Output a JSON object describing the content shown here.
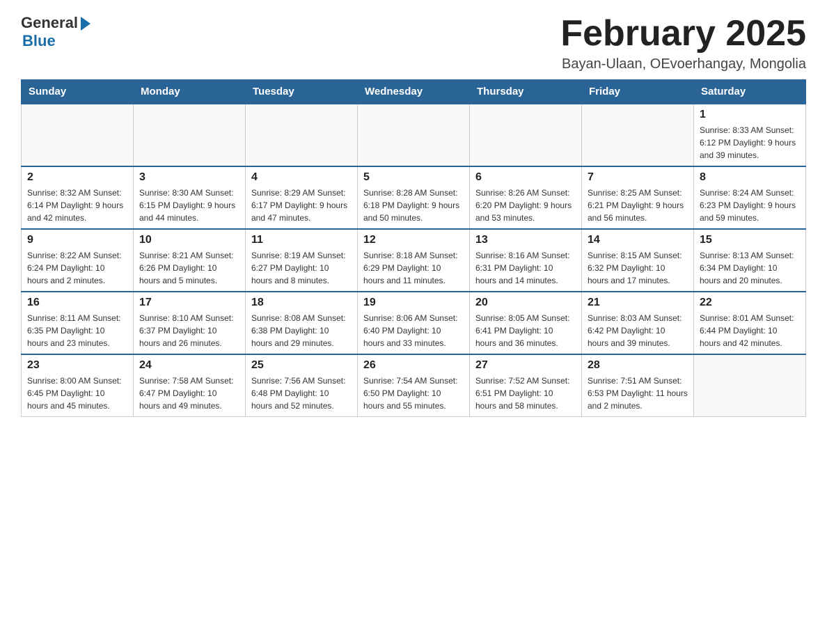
{
  "logo": {
    "general": "General",
    "blue": "Blue"
  },
  "title": "February 2025",
  "subtitle": "Bayan-Ulaan, OEvoerhangay, Mongolia",
  "days_header": [
    "Sunday",
    "Monday",
    "Tuesday",
    "Wednesday",
    "Thursday",
    "Friday",
    "Saturday"
  ],
  "weeks": [
    [
      {
        "day": "",
        "info": ""
      },
      {
        "day": "",
        "info": ""
      },
      {
        "day": "",
        "info": ""
      },
      {
        "day": "",
        "info": ""
      },
      {
        "day": "",
        "info": ""
      },
      {
        "day": "",
        "info": ""
      },
      {
        "day": "1",
        "info": "Sunrise: 8:33 AM\nSunset: 6:12 PM\nDaylight: 9 hours and 39 minutes."
      }
    ],
    [
      {
        "day": "2",
        "info": "Sunrise: 8:32 AM\nSunset: 6:14 PM\nDaylight: 9 hours and 42 minutes."
      },
      {
        "day": "3",
        "info": "Sunrise: 8:30 AM\nSunset: 6:15 PM\nDaylight: 9 hours and 44 minutes."
      },
      {
        "day": "4",
        "info": "Sunrise: 8:29 AM\nSunset: 6:17 PM\nDaylight: 9 hours and 47 minutes."
      },
      {
        "day": "5",
        "info": "Sunrise: 8:28 AM\nSunset: 6:18 PM\nDaylight: 9 hours and 50 minutes."
      },
      {
        "day": "6",
        "info": "Sunrise: 8:26 AM\nSunset: 6:20 PM\nDaylight: 9 hours and 53 minutes."
      },
      {
        "day": "7",
        "info": "Sunrise: 8:25 AM\nSunset: 6:21 PM\nDaylight: 9 hours and 56 minutes."
      },
      {
        "day": "8",
        "info": "Sunrise: 8:24 AM\nSunset: 6:23 PM\nDaylight: 9 hours and 59 minutes."
      }
    ],
    [
      {
        "day": "9",
        "info": "Sunrise: 8:22 AM\nSunset: 6:24 PM\nDaylight: 10 hours and 2 minutes."
      },
      {
        "day": "10",
        "info": "Sunrise: 8:21 AM\nSunset: 6:26 PM\nDaylight: 10 hours and 5 minutes."
      },
      {
        "day": "11",
        "info": "Sunrise: 8:19 AM\nSunset: 6:27 PM\nDaylight: 10 hours and 8 minutes."
      },
      {
        "day": "12",
        "info": "Sunrise: 8:18 AM\nSunset: 6:29 PM\nDaylight: 10 hours and 11 minutes."
      },
      {
        "day": "13",
        "info": "Sunrise: 8:16 AM\nSunset: 6:31 PM\nDaylight: 10 hours and 14 minutes."
      },
      {
        "day": "14",
        "info": "Sunrise: 8:15 AM\nSunset: 6:32 PM\nDaylight: 10 hours and 17 minutes."
      },
      {
        "day": "15",
        "info": "Sunrise: 8:13 AM\nSunset: 6:34 PM\nDaylight: 10 hours and 20 minutes."
      }
    ],
    [
      {
        "day": "16",
        "info": "Sunrise: 8:11 AM\nSunset: 6:35 PM\nDaylight: 10 hours and 23 minutes."
      },
      {
        "day": "17",
        "info": "Sunrise: 8:10 AM\nSunset: 6:37 PM\nDaylight: 10 hours and 26 minutes."
      },
      {
        "day": "18",
        "info": "Sunrise: 8:08 AM\nSunset: 6:38 PM\nDaylight: 10 hours and 29 minutes."
      },
      {
        "day": "19",
        "info": "Sunrise: 8:06 AM\nSunset: 6:40 PM\nDaylight: 10 hours and 33 minutes."
      },
      {
        "day": "20",
        "info": "Sunrise: 8:05 AM\nSunset: 6:41 PM\nDaylight: 10 hours and 36 minutes."
      },
      {
        "day": "21",
        "info": "Sunrise: 8:03 AM\nSunset: 6:42 PM\nDaylight: 10 hours and 39 minutes."
      },
      {
        "day": "22",
        "info": "Sunrise: 8:01 AM\nSunset: 6:44 PM\nDaylight: 10 hours and 42 minutes."
      }
    ],
    [
      {
        "day": "23",
        "info": "Sunrise: 8:00 AM\nSunset: 6:45 PM\nDaylight: 10 hours and 45 minutes."
      },
      {
        "day": "24",
        "info": "Sunrise: 7:58 AM\nSunset: 6:47 PM\nDaylight: 10 hours and 49 minutes."
      },
      {
        "day": "25",
        "info": "Sunrise: 7:56 AM\nSunset: 6:48 PM\nDaylight: 10 hours and 52 minutes."
      },
      {
        "day": "26",
        "info": "Sunrise: 7:54 AM\nSunset: 6:50 PM\nDaylight: 10 hours and 55 minutes."
      },
      {
        "day": "27",
        "info": "Sunrise: 7:52 AM\nSunset: 6:51 PM\nDaylight: 10 hours and 58 minutes."
      },
      {
        "day": "28",
        "info": "Sunrise: 7:51 AM\nSunset: 6:53 PM\nDaylight: 11 hours and 2 minutes."
      },
      {
        "day": "",
        "info": ""
      }
    ]
  ]
}
